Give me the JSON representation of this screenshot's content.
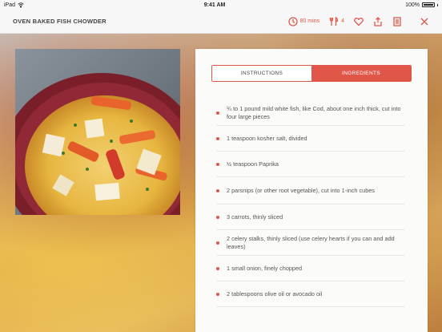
{
  "status_bar": {
    "device": "iPad",
    "time": "9:41 AM",
    "battery": "100%"
  },
  "header": {
    "title": "OVEN BAKED FISH CHOWDER",
    "time_label": "80 mins",
    "servings_label": "4",
    "icons": [
      "clock-icon",
      "utensils-icon",
      "heart-icon",
      "share-icon",
      "notes-icon",
      "close-icon"
    ]
  },
  "tabs": [
    {
      "label": "INSTRUCTIONS",
      "active": false
    },
    {
      "label": "INGREDIENTS",
      "active": true
    }
  ],
  "ingredients": [
    "¾ to 1 pound mild white fish, like Cod, about one inch thick, cut into four large pieces",
    "1 teaspoon kosher salt, divided",
    "½ teaspoon Paprika",
    "2 parsnips (or other root vegetable), cut into 1-inch cubes",
    "3 carrots, thinly sliced",
    "2 celery stalks, thinly sliced (use celery hearts if you can and add leaves)",
    "1 small onion, finely chopped",
    "2 tablespoons olive oil or avocado oil"
  ],
  "colors": {
    "accent": "#e0574a",
    "text": "#555555",
    "header_bg": "#f7f7f7"
  }
}
